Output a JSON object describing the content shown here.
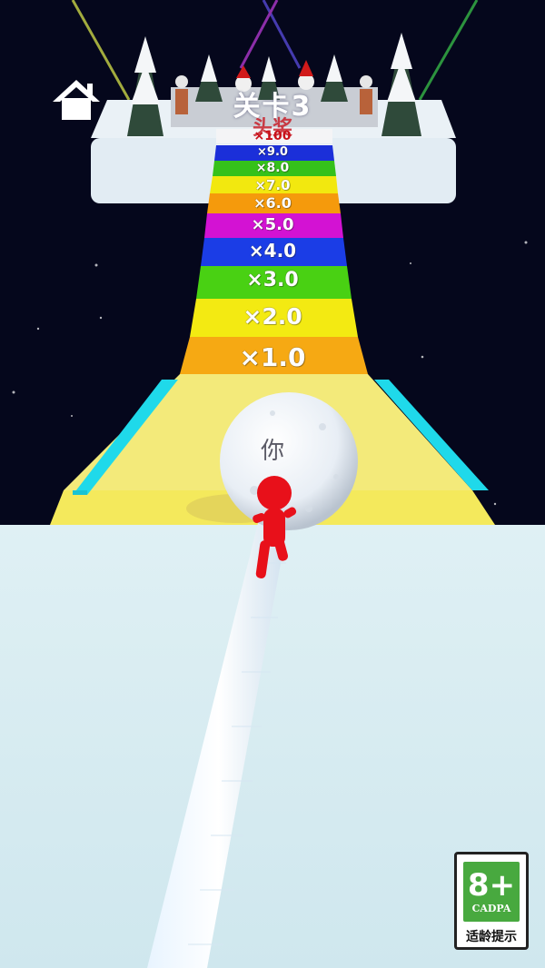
{
  "hud": {
    "level_title": "关卡3",
    "reward_label": "头奖",
    "home_icon": "home-icon"
  },
  "track": {
    "top_multiplier": "×100",
    "multipliers": [
      {
        "label": "×9.0",
        "color": "#1b2fd9"
      },
      {
        "label": "×8.0",
        "color": "#35c11a"
      },
      {
        "label": "×7.0",
        "color": "#f2e80f"
      },
      {
        "label": "×6.0",
        "color": "#f59a0c"
      },
      {
        "label": "×5.0",
        "color": "#d312d3"
      },
      {
        "label": "×4.0",
        "color": "#1b3de6"
      },
      {
        "label": "×3.0",
        "color": "#49d113"
      },
      {
        "label": "×2.0",
        "color": "#f3ea12"
      },
      {
        "label": "×1.0",
        "color": "#f6a913"
      }
    ]
  },
  "player": {
    "ball_label": "你",
    "color": "#e8101a"
  },
  "age_rating": {
    "number": "8+",
    "org": "CADPA",
    "tip": "适龄提示",
    "color": "#48a93f"
  }
}
